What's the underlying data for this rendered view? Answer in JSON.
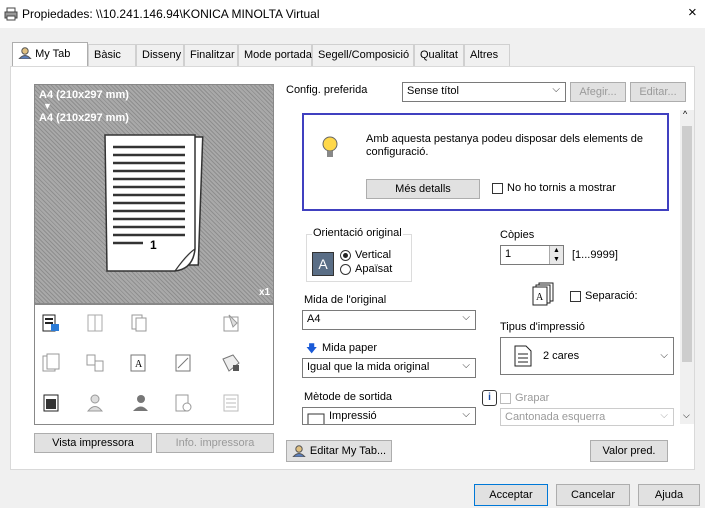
{
  "window": {
    "title": "Propiedades: \\\\10.241.146.94\\KONICA MINOLTA Virtual",
    "close": "×"
  },
  "tabs": [
    "My Tab",
    "Bàsic",
    "Disseny",
    "Finalitzar",
    "Mode portada",
    "Segell/Composició",
    "Qualitat",
    "Altres"
  ],
  "preview": {
    "size_top": "A4 (210x297 mm)",
    "arrow": "▼",
    "size_bottom": "A4 (210x297 mm)",
    "copies_badge": "x1",
    "page_number": "1"
  },
  "left_buttons": {
    "vista": "Vista impressora",
    "info": "Info. impressora"
  },
  "config": {
    "label": "Config. preferida",
    "value": "Sense títol",
    "afegir": "Afegir...",
    "editar": "Editar..."
  },
  "info": {
    "text": "Amb aquesta pestanya podeu disposar dels elements de configuració.",
    "mes_detalls": "Més detalls",
    "no_mostrar": "No ho tornis a mostrar"
  },
  "orientation": {
    "group_label": "Orientació original",
    "vertical": "Vertical",
    "apaisat": "Apaïsat",
    "selected": "Vertical"
  },
  "mida_original": {
    "label": "Mida de l'original",
    "value": "A4"
  },
  "mida_paper": {
    "label": "Mida paper",
    "value": "Igual que la mida original"
  },
  "metode_sortida": {
    "label": "Mètode de sortida",
    "value": "Impressió"
  },
  "copies": {
    "label": "Còpies",
    "value": "1",
    "range": "[1...9999]"
  },
  "separacio": {
    "label": "Separació:",
    "checked": false
  },
  "tipus": {
    "label": "Tipus d'impressió",
    "value": "2 cares"
  },
  "grapar": {
    "label": "Grapar",
    "value": "Cantonada esquerra"
  },
  "bottom": {
    "editar_mytab": "Editar My Tab...",
    "valor_pred": "Valor pred.",
    "acceptar": "Acceptar",
    "cancelar": "Cancelar",
    "ajuda": "Ajuda"
  },
  "colors": {
    "accent_border": "#4040c0",
    "focus_border": "#0078d7"
  }
}
